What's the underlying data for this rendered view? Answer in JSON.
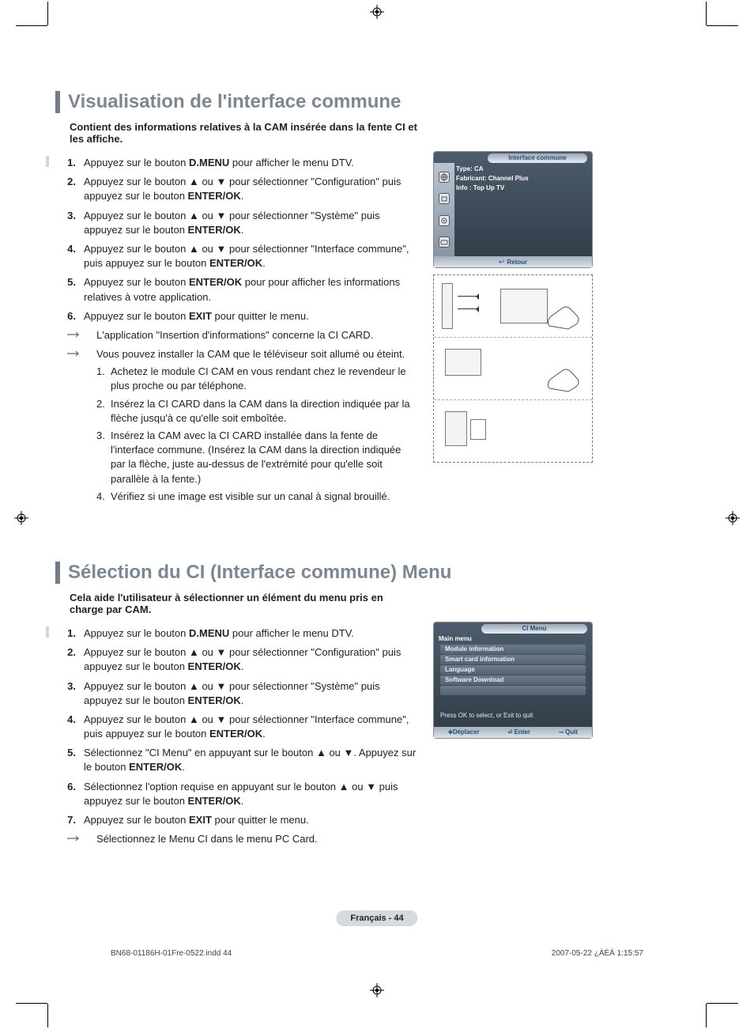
{
  "section1": {
    "title": "Visualisation de l'interface commune",
    "intro": "Contient des informations relatives à la CAM insérée dans la fente CI et les affiche.",
    "steps": [
      {
        "prefix": "Appuyez sur le bouton ",
        "bold": "D.MENU",
        "suffix": " pour afficher le menu DTV."
      },
      {
        "text1": "Appuyez sur le bouton ▲ ou ▼ pour sélectionner \"Configuration\" puis appuyez sur le bouton ",
        "bold": "ENTER/OK",
        "suffix": "."
      },
      {
        "text1": "Appuyez sur le bouton ▲ ou ▼ pour sélectionner \"Système\" puis appuyez sur le bouton ",
        "bold": "ENTER/OK",
        "suffix": "."
      },
      {
        "text1": "Appuyez sur le bouton ▲ ou ▼ pour sélectionner \"Interface commune\", puis appuyez sur le bouton ",
        "bold": "ENTER/OK",
        "suffix": "."
      },
      {
        "text1": "Appuyez sur le bouton ",
        "bold": "ENTER/OK",
        "suffix": " pour pour afficher les informations relatives à votre application."
      },
      {
        "text1": "Appuyez sur le bouton ",
        "bold": "EXIT",
        "suffix": " pour quitter le menu."
      }
    ],
    "note1": "L'application \"Insertion d'informations\" concerne la CI CARD.",
    "note2": "Vous pouvez installer la CAM que le téléviseur soit allumé ou éteint.",
    "substeps": [
      "Achetez le module CI CAM en vous rendant chez le revendeur le plus proche ou par téléphone.",
      "Insérez la CI CARD dans la CAM dans la direction indiquée par la flèche jusqu'à ce qu'elle soit emboîtée.",
      "Insérez la CAM avec la CI CARD installée dans la fente de l'interface commune. (Insérez la CAM dans la direction indiquée par la flèche, juste au-dessus de l'extrémité pour qu'elle soit parallèle à la fente.)",
      "Vérifiez si une image est visible sur un canal à signal brouillé."
    ]
  },
  "section2": {
    "title": "Sélection du CI (Interface commune) Menu",
    "intro": "Cela aide l'utilisateur à sélectionner un élément du menu pris en charge par CAM.",
    "steps": [
      {
        "prefix": "Appuyez sur le bouton ",
        "bold": "D.MENU",
        "suffix": " pour afficher le menu DTV."
      },
      {
        "text1": "Appuyez sur le bouton ▲ ou ▼ pour sélectionner \"Configuration\" puis appuyez sur le bouton ",
        "bold": "ENTER/OK",
        "suffix": "."
      },
      {
        "text1": "Appuyez sur le bouton ▲ ou ▼ pour sélectionner \"Système\" puis appuyez sur le bouton ",
        "bold": "ENTER/OK",
        "suffix": "."
      },
      {
        "text1": "Appuyez sur le bouton ▲ ou ▼ pour sélectionner \"Interface commune\", puis appuyez sur le bouton ",
        "bold": "ENTER/OK",
        "suffix": "."
      },
      {
        "text1": "Sélectionnez \"CI Menu\" en appuyant sur le bouton ▲ ou ▼. Appuyez sur le bouton ",
        "bold": "ENTER/OK",
        "suffix": "."
      },
      {
        "text1": "Sélectionnez l'option requise en appuyant sur le bouton ▲ ou ▼ puis appuyez sur le bouton ",
        "bold": "ENTER/OK",
        "suffix": "."
      },
      {
        "text1": "Appuyez sur le bouton ",
        "bold": "EXIT",
        "suffix": " pour quitter le menu."
      }
    ],
    "note": "Sélectionnez le Menu CI dans le menu PC Card."
  },
  "osd1": {
    "title": "Interface commune",
    "line1": "Type: CA",
    "line2": "Fabricant: Channel Plus",
    "line3": "Info : Top Up TV",
    "return": "Retour"
  },
  "osd2": {
    "title": "CI Menu",
    "main": "Main menu",
    "items": [
      "Module information",
      "Smart card information",
      "Language",
      "Software Download"
    ],
    "hint": "Press OK to select, or Exit to quit",
    "foot": {
      "move": "Déplacer",
      "enter": "Enter",
      "quit": "Quit"
    }
  },
  "footer": {
    "pill": "Français - 44",
    "source": "BN68-01186H-01Fre-0522.indd   44",
    "datetime": "2007-05-22   ¿ÀÈÄ 1:15:57"
  }
}
